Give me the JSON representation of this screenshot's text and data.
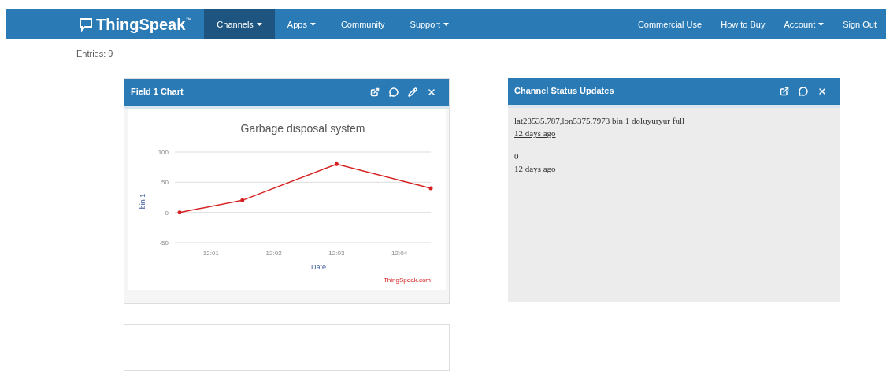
{
  "navbar": {
    "logo": "ThingSpeak",
    "trademark": "™",
    "left_items": [
      {
        "label": "Channels",
        "dropdown": true,
        "selected": true
      },
      {
        "label": "Apps",
        "dropdown": true,
        "selected": false
      },
      {
        "label": "Community",
        "dropdown": false,
        "selected": false
      },
      {
        "label": "Support",
        "dropdown": true,
        "selected": false
      }
    ],
    "right_items": [
      {
        "label": "Commercial Use",
        "dropdown": false
      },
      {
        "label": "How to Buy",
        "dropdown": false
      },
      {
        "label": "Account",
        "dropdown": true
      },
      {
        "label": "Sign Out",
        "dropdown": false
      }
    ]
  },
  "channel_info": {
    "entries": "Entries: 9"
  },
  "chart_panel": {
    "title": "Field 1 Chart",
    "credit": "ThingSpeak.com",
    "chart_data": {
      "type": "line",
      "title": "Garbage disposal system",
      "xlabel": "Date",
      "ylabel": "bin 1",
      "categories": [
        null,
        "12:01",
        null,
        "12:02",
        null,
        "12:03",
        null,
        "12:04",
        null
      ],
      "series": [
        {
          "color": "#d62020",
          "values": [
            0,
            null,
            20,
            null,
            null,
            80,
            null,
            null,
            40
          ]
        }
      ],
      "ylim": [
        -50,
        100
      ],
      "yticks": [
        -50,
        0,
        50,
        100
      ]
    }
  },
  "status_panel": {
    "title": "Channel Status Updates",
    "updates": [
      {
        "text": "lat23535.787,lon5375.7973 bin 1 doluyuryur full",
        "time": "12 days ago"
      },
      {
        "text": "0",
        "time": "12 days ago"
      }
    ]
  }
}
